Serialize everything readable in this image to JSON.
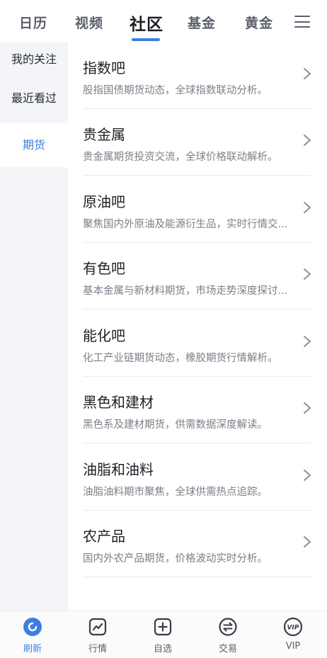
{
  "top_tabs": [
    {
      "label": "日历"
    },
    {
      "label": "视频"
    },
    {
      "label": "社区"
    },
    {
      "label": "基金"
    },
    {
      "label": "黄金"
    }
  ],
  "active_tab": "社区",
  "sidebar": {
    "items": [
      {
        "label": "我的关注"
      },
      {
        "label": "最近看过"
      },
      {
        "label": "期货"
      }
    ],
    "active": "期货"
  },
  "list": [
    {
      "title": "指数吧",
      "desc": "股指国债期货动态，全球指数联动分析。"
    },
    {
      "title": "贵金属",
      "desc": "贵金属期货投资交流，全球价格联动解析。"
    },
    {
      "title": "原油吧",
      "desc": "聚焦国内外原油及能源衍生品，实时行情交..."
    },
    {
      "title": "有色吧",
      "desc": "基本金属与新材料期货，市场走势深度探讨..."
    },
    {
      "title": "能化吧",
      "desc": "化工产业链期货动态，橡胶期货行情解析。"
    },
    {
      "title": "黑色和建材",
      "desc": "黑色系及建材期货，供需数据深度解读。"
    },
    {
      "title": "油脂和油料",
      "desc": "油脂油料期市聚焦，全球供需热点追踪。"
    },
    {
      "title": "农产品",
      "desc": "国内外农产品期货，价格波动实时分析。"
    }
  ],
  "bottom_nav": [
    {
      "label": "刷新",
      "icon": "refresh-icon"
    },
    {
      "label": "行情",
      "icon": "market-chart-icon"
    },
    {
      "label": "自选",
      "icon": "add-watchlist-icon"
    },
    {
      "label": "交易",
      "icon": "trade-exchange-icon"
    },
    {
      "label": "VIP",
      "icon": "vip-icon"
    }
  ],
  "colors": {
    "accent": "#3d7fe0",
    "sidebar_bg": "#f3f5f9",
    "text_primary": "#1e2026",
    "text_secondary": "#7b7f88"
  }
}
